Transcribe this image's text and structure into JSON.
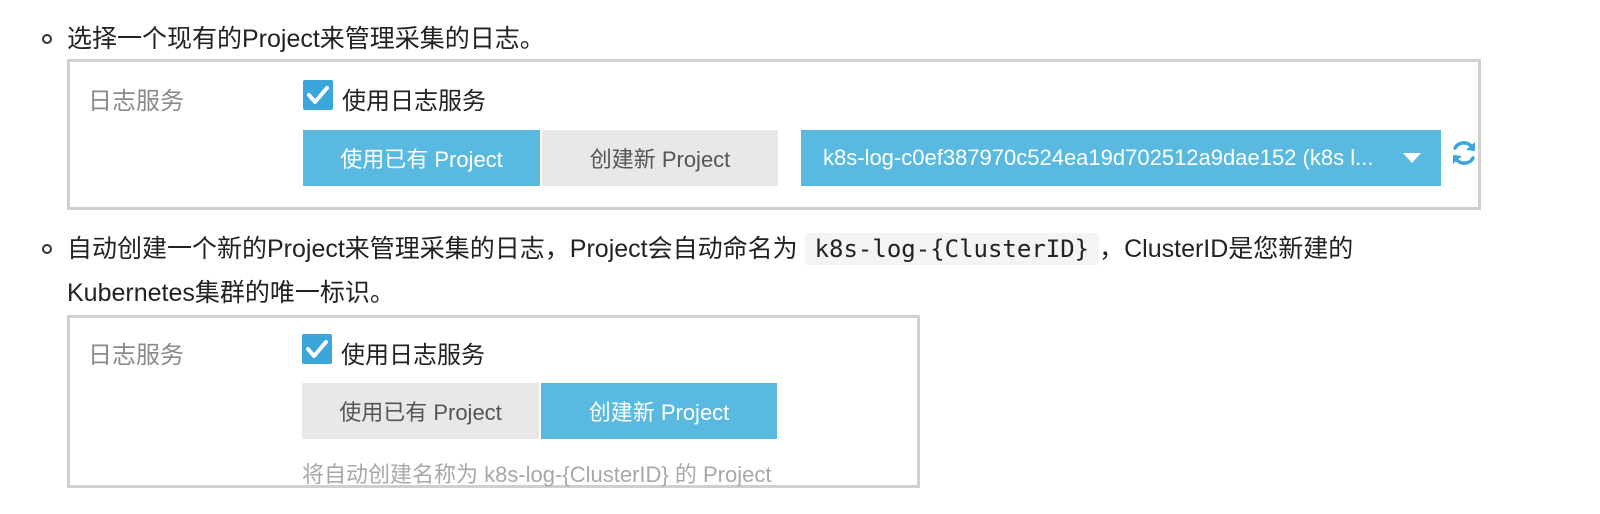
{
  "items": [
    {
      "text": "选择一个现有的Project来管理采集的日志。"
    },
    {
      "text_before": "自动创建一个新的Project来管理采集的日志，Project会自动命名为",
      "code": "k8s-log-{ClusterID}",
      "text_after": "，ClusterID是您新建的",
      "text_line2": "Kubernetes集群的唯一标识。"
    }
  ],
  "panel1": {
    "label": "日志服务",
    "checkbox_label": "使用日志服务",
    "checked": true,
    "btn_existing": "使用已有 Project",
    "btn_new": "创建新 Project",
    "active": "existing",
    "select_value": "k8s-log-c0ef387970c524ea19d702512a9dae152 (k8s l..."
  },
  "panel2": {
    "label": "日志服务",
    "checkbox_label": "使用日志服务",
    "checked": true,
    "btn_existing": "使用已有 Project",
    "btn_new": "创建新 Project",
    "active": "new",
    "hint": "将自动创建名称为 k8s-log-{ClusterID} 的 Project"
  },
  "colors": {
    "accent": "#5ab9e0",
    "checkbox": "#3aa6d9",
    "inactive": "#e8e8e8",
    "border": "#cfcfcf"
  },
  "icons": [
    "check-icon",
    "refresh-icon",
    "caret-down-icon",
    "bullet-circle-icon"
  ]
}
